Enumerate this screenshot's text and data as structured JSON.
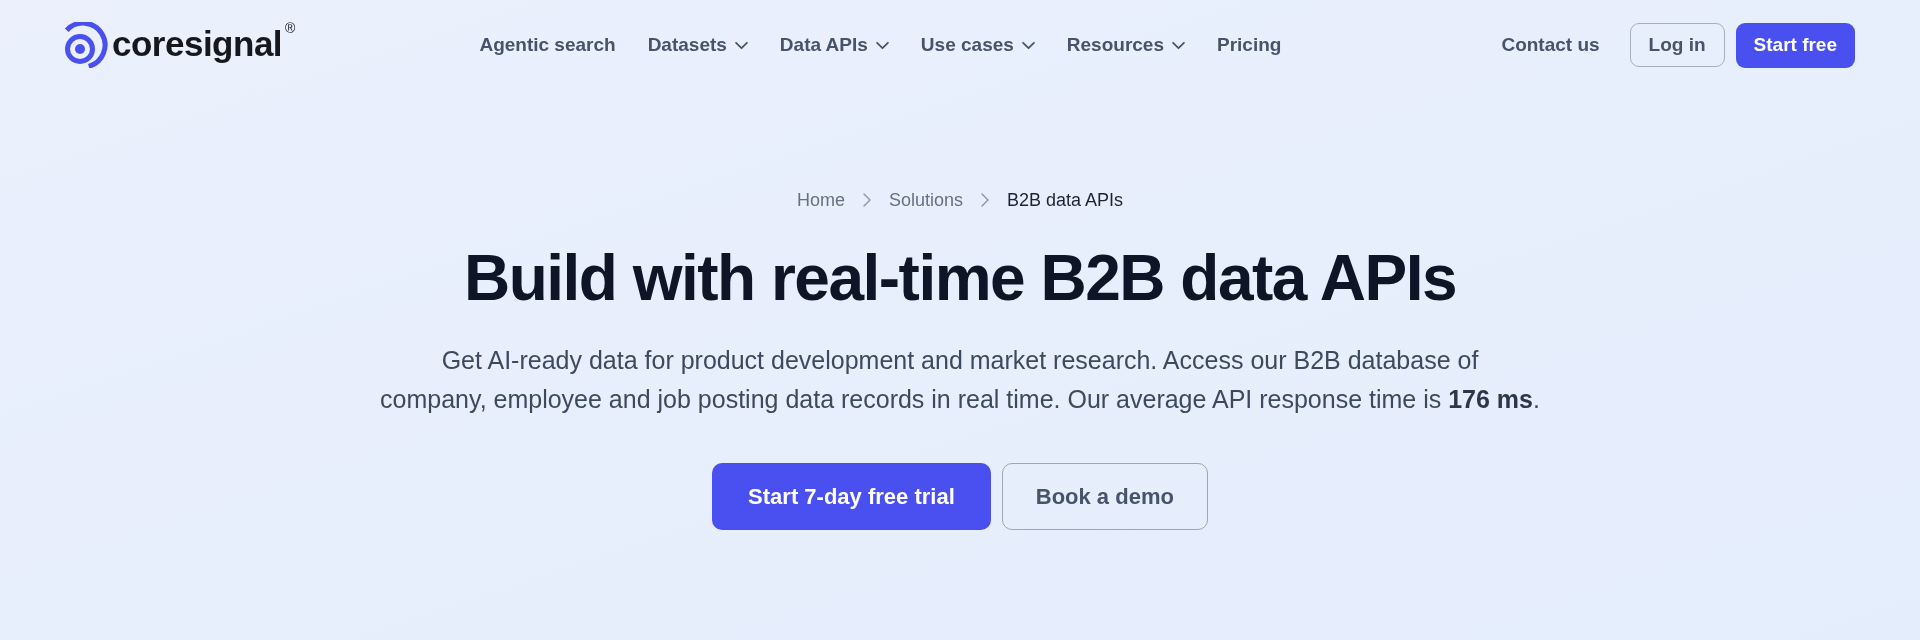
{
  "logo": {
    "wordmark": "coresignal",
    "registered_mark": "®"
  },
  "nav": {
    "items": [
      {
        "label": "Agentic search",
        "dropdown": false
      },
      {
        "label": "Datasets",
        "dropdown": true
      },
      {
        "label": "Data APIs",
        "dropdown": true
      },
      {
        "label": "Use cases",
        "dropdown": true
      },
      {
        "label": "Resources",
        "dropdown": true
      },
      {
        "label": "Pricing",
        "dropdown": false
      }
    ]
  },
  "actions": [
    {
      "label": "Contact us",
      "kind": "link"
    },
    {
      "label": "Log in",
      "kind": "outline"
    },
    {
      "label": "Start free",
      "kind": "primary"
    }
  ],
  "breadcrumb": [
    {
      "label": "Home",
      "current": false
    },
    {
      "label": "Solutions",
      "current": false
    },
    {
      "label": "B2B data APIs",
      "current": true
    }
  ],
  "hero": {
    "title": "Build with real-time B2B data APIs",
    "description_lines": [
      "Get AI-ready data for product development and market research. Access our B2B database of",
      "company, employee and job posting data records in real time. Our average API response time is **176 ms**."
    ],
    "buttons": [
      {
        "label": "Start 7-day free trial",
        "kind": "primary"
      },
      {
        "label": "Book a demo",
        "kind": "outline"
      }
    ]
  }
}
